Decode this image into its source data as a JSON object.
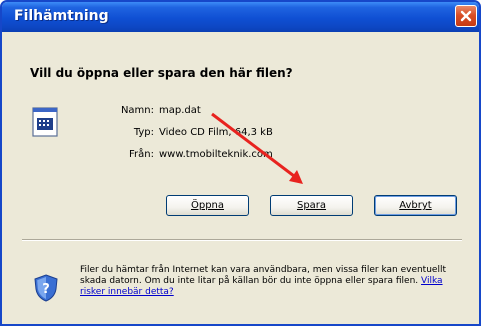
{
  "window": {
    "title": "Filhämtning",
    "close_label": "×"
  },
  "question": "Vill du öppna eller spara den här filen?",
  "file_info": {
    "icon": "file-icon",
    "rows": [
      {
        "label": "Namn:",
        "value": "map.dat"
      },
      {
        "label": "Typ:",
        "value": "Video CD Film, 64,3 kB"
      },
      {
        "label": "Från:",
        "value": "www.tmobilteknik.com"
      }
    ]
  },
  "buttons": {
    "open": "Öppna",
    "save": "Spara",
    "cancel": "Avbryt"
  },
  "warning": {
    "icon": "shield-icon",
    "text": "Filer du hämtar från Internet kan vara användbara, men vissa filer kan eventuellt skada datorn. Om du inte litar på källan bör du inte öppna eller spara filen.",
    "link": "Vilka risker innebär detta?"
  },
  "annotation": {
    "arrow_color": "#e8231f"
  }
}
